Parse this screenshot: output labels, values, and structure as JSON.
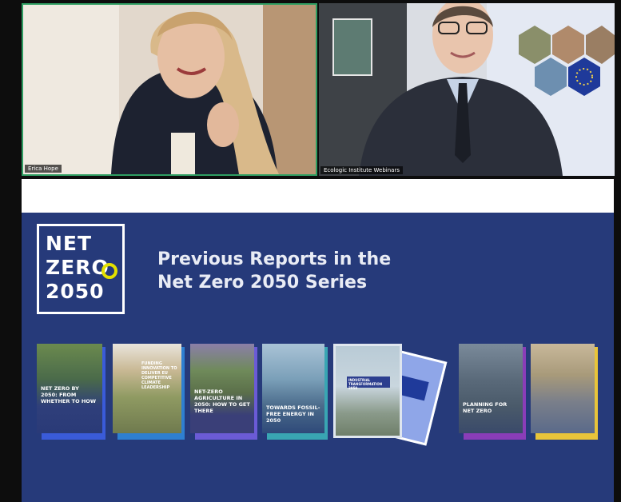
{
  "participants": [
    {
      "name": "Erica Hope"
    },
    {
      "name": "Ecologic Institute Webinars"
    }
  ],
  "slide": {
    "logo": {
      "line1": "NET",
      "line2": "ZERO",
      "line3": "2050"
    },
    "title_line1": "Previous Reports in the",
    "title_line2": "Net Zero 2050 Series",
    "reports": [
      {
        "title": "Net Zero by 2050: From Whether to How",
        "accent": "#3a5bd9"
      },
      {
        "title": "Funding Innovation to Deliver EU Competitive Climate Leadership",
        "accent": "#2e7fd1"
      },
      {
        "title": "Net-Zero Agriculture in 2050: How to Get There",
        "accent": "#6b5bd6"
      },
      {
        "title": "Towards Fossil-Free Energy in 2050",
        "accent": "#39a6b3"
      },
      {
        "title": "Industrial Transformation 2050",
        "accent": "#2d3f8f"
      },
      {
        "title": "",
        "accent": "#8fa6e8"
      },
      {
        "title": "Planning for Net Zero",
        "accent": "#8a3db8"
      },
      {
        "title": "",
        "accent": "#e8c43a"
      }
    ]
  },
  "colors": {
    "slide_bg": "#263a7a",
    "active_speaker_border": "#2f9e62"
  }
}
